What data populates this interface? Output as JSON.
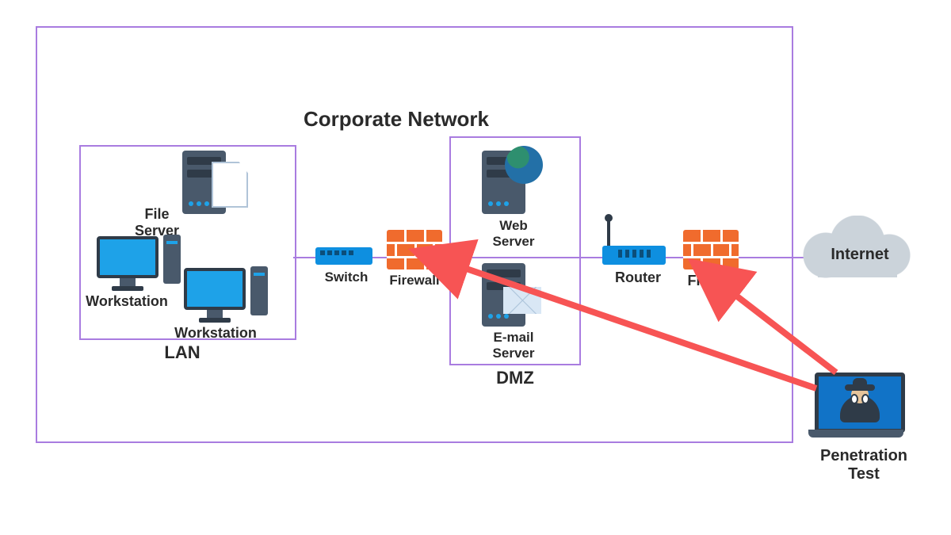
{
  "title": "Corporate Network",
  "zones": {
    "lan": {
      "label": "LAN",
      "nodes": {
        "workstation1": "Workstation",
        "workstation2": "Workstation",
        "file_server": "File Server"
      }
    },
    "dmz": {
      "label": "DMZ",
      "nodes": {
        "web_server": "Web Server",
        "email_server": "E-mail Server"
      }
    }
  },
  "devices": {
    "switch": "Switch",
    "firewall_inner": "Firewall",
    "firewall_outer": "Firewall",
    "router": "Router"
  },
  "external": {
    "internet": "Internet",
    "pentest": "Penetration Test"
  },
  "diagram": {
    "arrows_from": "pentest-laptop",
    "arrow_targets": [
      "firewall-inner",
      "firewall-outer"
    ],
    "flow_left_to_right": [
      "LAN",
      "Switch",
      "Firewall",
      "DMZ",
      "Router",
      "Firewall",
      "Internet"
    ]
  }
}
